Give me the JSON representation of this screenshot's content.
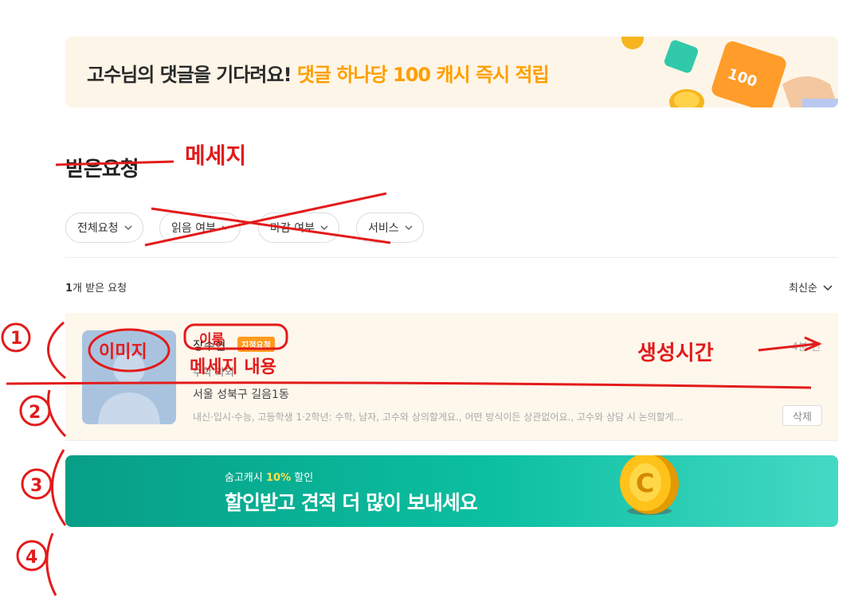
{
  "top_banner": {
    "text_prefix": "고수님의 댓글을 기다려요!",
    "text_highlight": "댓글 하나당 100 캐시 즉시 적립",
    "coin_label": "100"
  },
  "page": {
    "title": "받은요청"
  },
  "filters": [
    {
      "label": "전체요청"
    },
    {
      "label": "읽음 여부"
    },
    {
      "label": "마감 여부"
    },
    {
      "label": "서비스"
    }
  ],
  "list": {
    "count": "1",
    "count_suffix": "개 받은 요청",
    "sort_label": "최신순"
  },
  "request": {
    "name": "장수현",
    "badge": "지정요청",
    "time": "4분 전",
    "category": "수학 과외",
    "location": "서울 성북구 길음1동",
    "summary": "내신·입시·수능, 고등학생 1·2학년: 수학, 남자, 고수와 상의할게요., 어떤 방식이든 상관없어요., 고수와 상담 시 논의할게...",
    "delete_label": "삭제"
  },
  "cash_banner": {
    "sub_prefix": "숨고캐시",
    "sub_pct": "10%",
    "sub_suffix": "할인",
    "title": "할인받고 견적 더 많이 보내세요"
  },
  "annotations": {
    "title_replacement": "메세지",
    "image_note": "이미지",
    "name_note": "이름",
    "content_note": "메세지 내용",
    "time_note": "생성시간",
    "num1": "1",
    "num2": "2",
    "num3": "3",
    "num4": "4"
  },
  "colors": {
    "accent_orange": "#ff9a1e",
    "annotation_red": "#e31b1b",
    "teal": "#0bbfa0",
    "card_bg": "#fdf7ec"
  }
}
